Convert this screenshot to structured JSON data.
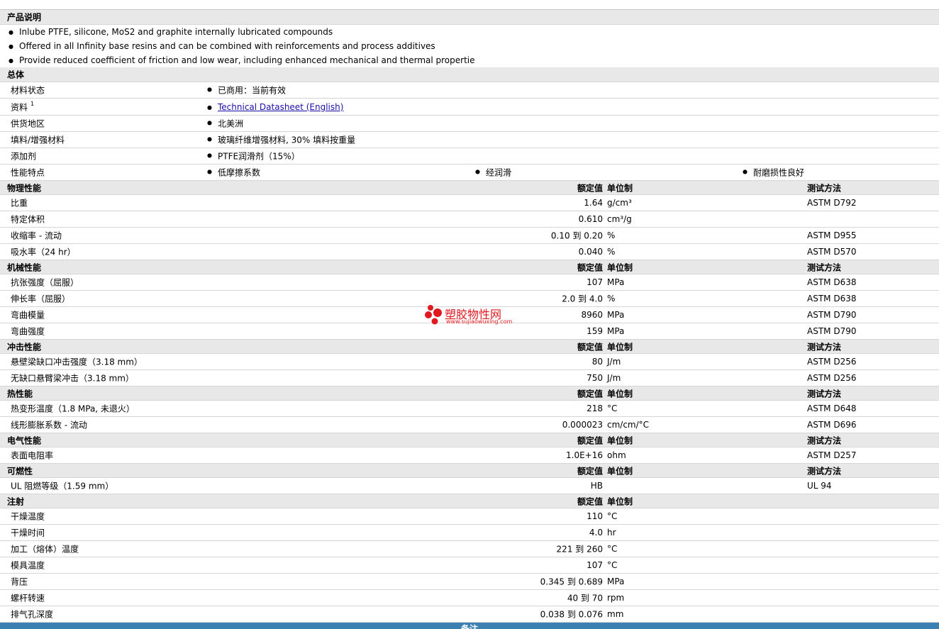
{
  "description": {
    "title": "产品说明",
    "bullets": [
      "Inlube PTFE, silicone, MoS2 and graphite internally lubricated compounds",
      "Offered in all Infinity base resins and can be combined with reinforcements and process additives",
      "Provide reduced coefficient of friction and low wear, including enhanced mechanical and thermal propertie"
    ]
  },
  "general": {
    "title": "总体",
    "rows": [
      {
        "label": "材料状态",
        "value": "已商用：当前有效"
      },
      {
        "label": "资料",
        "sup": "1",
        "link": "Technical Datasheet (English)"
      },
      {
        "label": "供货地区",
        "value": "北美洲"
      },
      {
        "label": "填料/增强材料",
        "value": "玻璃纤维增强材料, 30% 填料按重量"
      },
      {
        "label": "添加剂",
        "value": "PTFE润滑剂（15%）"
      },
      {
        "label": "性能特点",
        "values": [
          "低摩擦系数",
          "经润滑",
          "耐磨损性良好"
        ]
      }
    ]
  },
  "headers": {
    "nominal": "额定值",
    "unit": "单位制",
    "method": "测试方法"
  },
  "sections": [
    {
      "title": "物理性能",
      "show_method": true,
      "rows": [
        {
          "label": "比重",
          "value": "1.64",
          "unit": "g/cm³",
          "method": "ASTM D792"
        },
        {
          "label": "特定体积",
          "value": "0.610",
          "unit": "cm³/g",
          "method": ""
        },
        {
          "label": "收缩率 - 流动",
          "value": "0.10 到  0.20",
          "unit": "%",
          "method": "ASTM D955"
        },
        {
          "label": "吸水率（24 hr）",
          "value": "0.040",
          "unit": "%",
          "method": "ASTM D570"
        }
      ]
    },
    {
      "title": "机械性能",
      "show_method": true,
      "rows": [
        {
          "label": "抗张强度（屈服）",
          "value": "107",
          "unit": "MPa",
          "method": "ASTM D638"
        },
        {
          "label": "伸长率（屈服）",
          "value": "2.0 到  4.0",
          "unit": "%",
          "method": "ASTM D638"
        },
        {
          "label": "弯曲模量",
          "value": "8960",
          "unit": "MPa",
          "method": "ASTM D790"
        },
        {
          "label": "弯曲强度",
          "value": "159",
          "unit": "MPa",
          "method": "ASTM D790"
        }
      ]
    },
    {
      "title": "冲击性能",
      "show_method": true,
      "rows": [
        {
          "label": "悬壁梁缺口冲击强度（3.18 mm）",
          "value": "80",
          "unit": "J/m",
          "method": "ASTM D256"
        },
        {
          "label": "无缺口悬臂梁冲击（3.18 mm）",
          "value": "750",
          "unit": "J/m",
          "method": "ASTM D256"
        }
      ]
    },
    {
      "title": "热性能",
      "show_method": true,
      "rows": [
        {
          "label": "热变形温度（1.8 MPa, 未退火）",
          "value": "218",
          "unit": "°C",
          "method": "ASTM D648"
        },
        {
          "label": "线形膨胀系数 - 流动",
          "value": "0.000023",
          "unit": "cm/cm/°C",
          "method": "ASTM D696"
        }
      ]
    },
    {
      "title": "电气性能",
      "show_method": true,
      "rows": [
        {
          "label": "表面电阻率",
          "value": "1.0E+16",
          "unit": "ohm",
          "method": "ASTM D257"
        }
      ]
    },
    {
      "title": "可燃性",
      "show_method": true,
      "rows": [
        {
          "label": "UL 阻燃等级（1.59 mm）",
          "value": "HB",
          "unit": "",
          "method": "UL 94"
        }
      ]
    },
    {
      "title": "注射",
      "show_method": false,
      "rows": [
        {
          "label": "干燥温度",
          "value": "110",
          "unit": "°C",
          "method": ""
        },
        {
          "label": "干燥时间",
          "value": "4.0",
          "unit": "hr",
          "method": ""
        },
        {
          "label": "加工（熔体）温度",
          "value": "221 到  260",
          "unit": "°C",
          "method": ""
        },
        {
          "label": "模具温度",
          "value": "107",
          "unit": "°C",
          "method": ""
        },
        {
          "label": "背压",
          "value": "0.345 到  0.689",
          "unit": "MPa",
          "method": ""
        },
        {
          "label": "螺杆转速",
          "value": "40 到  70",
          "unit": "rpm",
          "method": ""
        },
        {
          "label": "排气孔深度",
          "value": "0.038 到  0.076",
          "unit": "mm",
          "method": ""
        }
      ]
    }
  ],
  "watermark": {
    "name": "塑胶物性网",
    "url": "www.sujiaowuxing.com",
    "color": "#e0191f"
  },
  "footer": {
    "label": "备注",
    "color": "#3c7fb1"
  }
}
